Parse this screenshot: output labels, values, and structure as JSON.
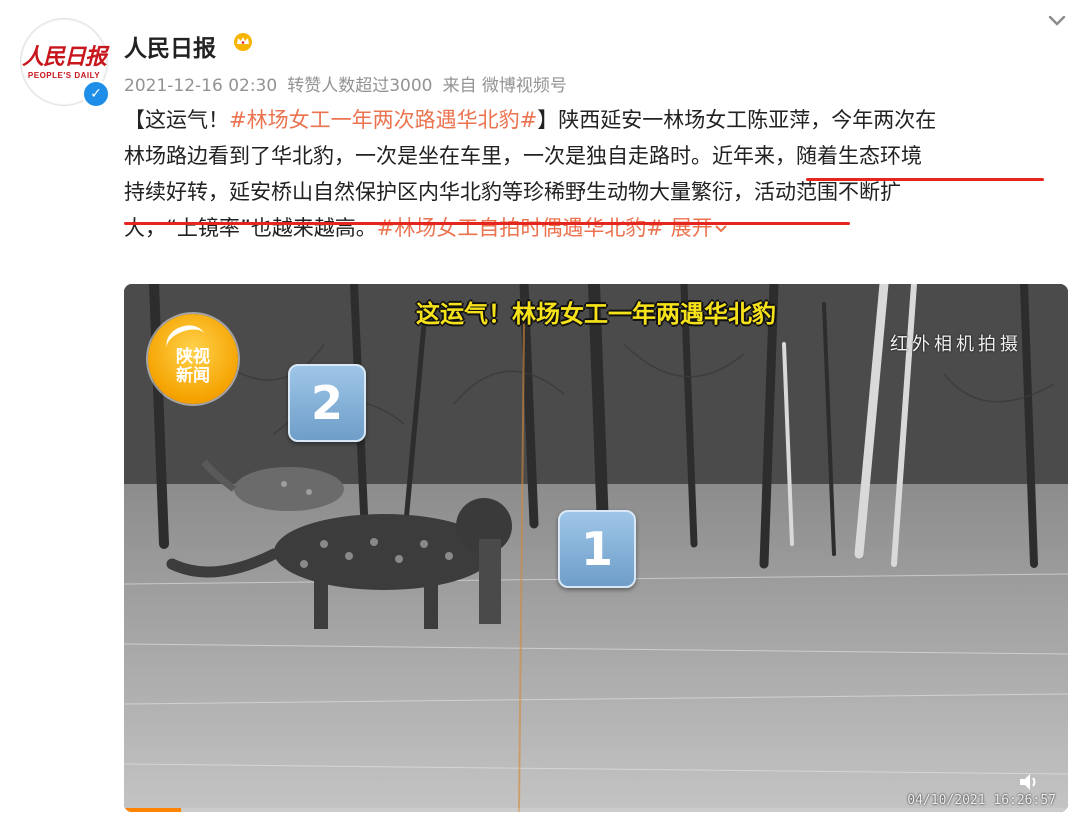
{
  "account": {
    "name": "人民日报",
    "logo_cn": "人民日报",
    "logo_en": "PEOPLE'S DAILY"
  },
  "meta": {
    "timestamp": "2021-12-16 02:30",
    "reposts": "转赞人数超过3000",
    "source": "来自 微博视频号"
  },
  "post": {
    "line1": [
      {
        "text": "【这运气！",
        "type": "text"
      },
      {
        "text": "#林场女工一年两次路遇华北豹#",
        "type": "tag"
      },
      {
        "text": "】陕西延安一林场女工陈亚萍，今年两次在",
        "type": "text"
      }
    ],
    "line2": "林场路边看到了华北豹，一次是坐在车里，一次是独自走路时。近年来，随着生态环境",
    "line3": "持续好转，延安桥山自然保护区内华北豹等珍稀野生动物大量繁衍，活动范围不断扩",
    "line4_text": "大，“上镜率”也越来越高。",
    "line4_tag": "#林场女工自拍时偶遇华北豹#",
    "expand": "展开"
  },
  "video": {
    "title": "这运气！林场女工一年两遇华北豹",
    "caption": "红外相机拍摄",
    "logo_text": "陕视\n新闻",
    "badge_1": "1",
    "badge_2": "2",
    "timestamp": "04/10/2021 16:26:57",
    "progress": 0.06
  },
  "colors": {
    "tag": "#eb7350",
    "underline": "#e5261f",
    "verified": "#1e8ee8",
    "title_yellow": "#f6e21a"
  },
  "icons": [
    "crown-icon",
    "verified-icon",
    "chevron-down-icon",
    "volume-icon"
  ]
}
